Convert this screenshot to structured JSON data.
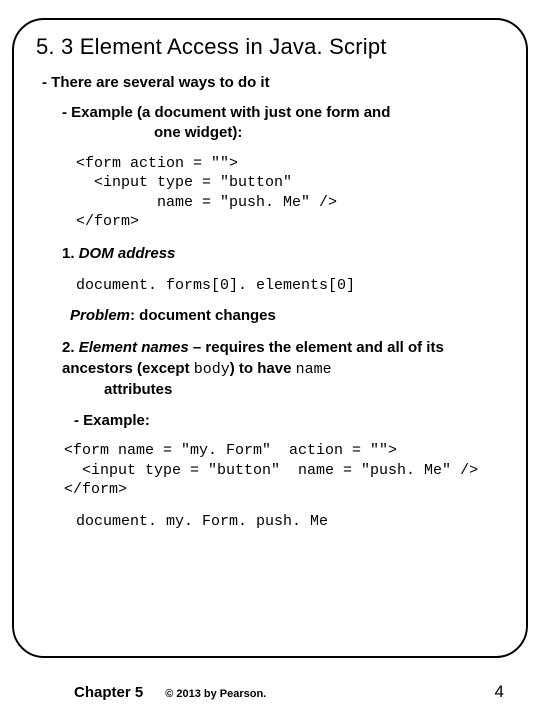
{
  "title": "5. 3 Element Access in Java. Script",
  "intro": "- There are several ways to do it",
  "example_lead": "- Example (a document with just one form and",
  "example_lead2": "one widget):",
  "code1": "<form action = \"\">\n  <input type = \"button\"\n         name = \"push. Me\" />\n</form>",
  "item1_num": "1. ",
  "item1_title": "DOM address",
  "code2": "document. forms[0]. elements[0]",
  "problem_pfx": "Problem",
  "problem_rest": ": document changes",
  "item2_num": "2. ",
  "item2_title": "Element names",
  "item2_rest_a": " – requires the element and all of its ancestors (except ",
  "item2_body": "body",
  "item2_rest_b": ") to have ",
  "item2_name": "name",
  "item2_rest_c": " attributes",
  "sub_example": "- Example:",
  "code3": "<form name = \"my. Form\"  action = \"\">\n  <input type = \"button\"  name = \"push. Me\" />\n</form>",
  "code4": "document. my. Form. push. Me",
  "footer": {
    "chapter": "Chapter 5",
    "copyright": "© 2013 by Pearson.",
    "page": "4"
  }
}
